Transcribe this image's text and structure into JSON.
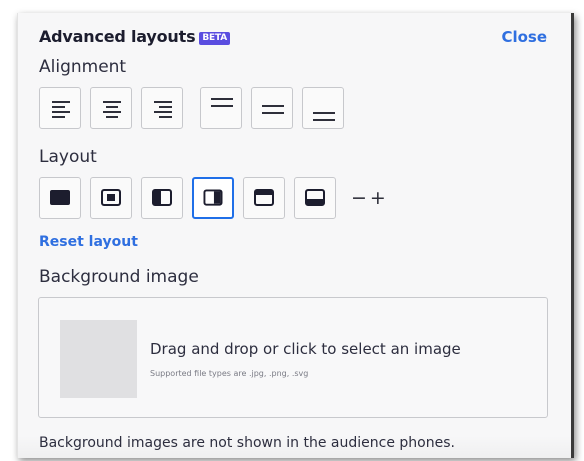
{
  "panel": {
    "title": "Advanced layouts",
    "badge": "BETA",
    "close_label": "Close"
  },
  "alignment": {
    "label": "Alignment",
    "buttons": [
      {
        "name": "align-left",
        "icon": "align-left-icon"
      },
      {
        "name": "align-center",
        "icon": "align-center-icon"
      },
      {
        "name": "align-right",
        "icon": "align-right-icon"
      },
      {
        "name": "align-top",
        "icon": "align-top-icon"
      },
      {
        "name": "align-middle",
        "icon": "align-middle-icon"
      },
      {
        "name": "align-bottom",
        "icon": "align-bottom-icon"
      }
    ]
  },
  "layout": {
    "label": "Layout",
    "options": [
      {
        "name": "full",
        "icon": "layout-full-icon",
        "selected": false
      },
      {
        "name": "center",
        "icon": "layout-center-icon",
        "selected": false
      },
      {
        "name": "left",
        "icon": "layout-left-icon",
        "selected": false
      },
      {
        "name": "right",
        "icon": "layout-right-icon",
        "selected": true
      },
      {
        "name": "top",
        "icon": "layout-top-icon",
        "selected": false
      },
      {
        "name": "bottom",
        "icon": "layout-bottom-icon",
        "selected": false
      }
    ],
    "size_controls": "−+",
    "reset_label": "Reset layout"
  },
  "background": {
    "label": "Background image",
    "drop_text": "Drag and drop or click to select an image",
    "supported_text": "Supported file types are .jpg, .png, .svg",
    "note": "Background images are not shown in the audience phones."
  },
  "colors": {
    "accent": "#2f6fe0",
    "selected_border": "#1f6fe8",
    "badge": "#5a4de0",
    "icon": "#1c1d2e"
  }
}
